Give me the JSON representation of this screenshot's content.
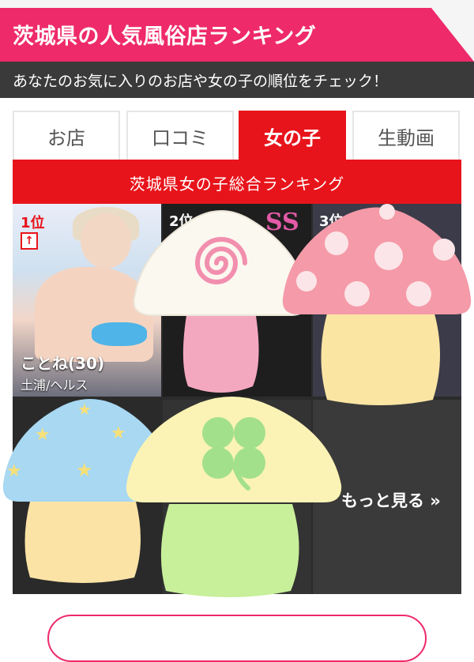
{
  "header": {
    "title": "茨城県の人気風俗店ランキング"
  },
  "subheader": {
    "text": "あなたのお気に入りのお店や女の子の順位をチェック！"
  },
  "tabs": [
    {
      "label": "お店"
    },
    {
      "label": "口コミ"
    },
    {
      "label": "女の子"
    },
    {
      "label": "生動画"
    }
  ],
  "active_tab": "女の子",
  "ranking": {
    "title": "茨城県女の子総合ランキング",
    "items": [
      {
        "rank": "1位",
        "name": "ことね(30)",
        "area": "土浦/ヘルス"
      },
      {
        "rank": "2位",
        "logo": "SS"
      },
      {
        "rank": "3位"
      }
    ],
    "more_label": "もっと見る »",
    "up_arrow": "↑"
  },
  "colors": {
    "header_pink": "#ee2a6a",
    "ranking_red": "#e8141b",
    "subheader_dark": "#3a3a3a"
  },
  "stickers": [
    "swirl-mushroom-sticker",
    "polka-dot-mushroom-sticker",
    "star-mushroom-sticker",
    "clover-mushroom-sticker"
  ]
}
